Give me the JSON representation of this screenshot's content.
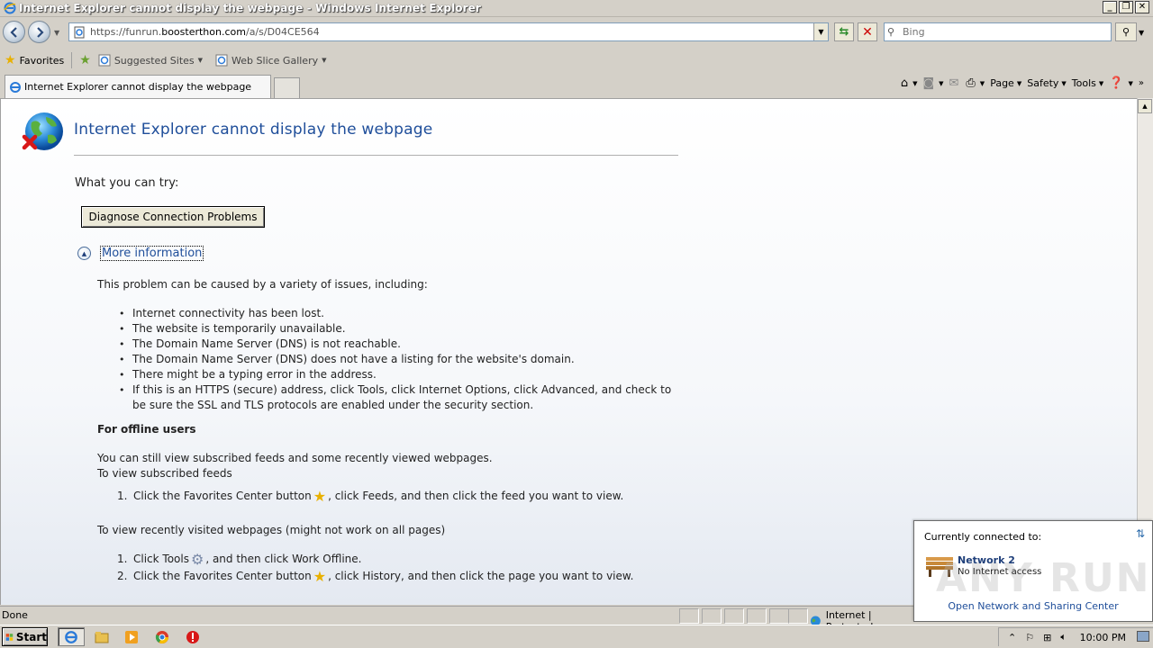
{
  "window": {
    "title": "Internet Explorer cannot display the webpage - Windows Internet Explorer",
    "controls": [
      "_",
      "❐",
      "✕"
    ]
  },
  "address": {
    "url_prefix": "https://funrun.",
    "url_domain": "boosterthon.com",
    "url_suffix": "/a/s/D04CE564"
  },
  "search": {
    "placeholder": "Bing"
  },
  "favorites_bar": {
    "favorites": "Favorites",
    "suggested_sites": "Suggested Sites",
    "web_slice_gallery": "Web Slice Gallery"
  },
  "tabs": [
    {
      "label": "Internet Explorer cannot display the webpage"
    }
  ],
  "command_bar": {
    "page": "Page",
    "safety": "Safety",
    "tools": "Tools"
  },
  "error_page": {
    "title": "Internet Explorer cannot display the webpage",
    "what_you_can_try": "What you can try:",
    "diagnose_button": "Diagnose Connection Problems",
    "more_information": "More information",
    "problem_intro": "This problem can be caused by a variety of issues, including:",
    "causes": [
      "Internet connectivity has been lost.",
      "The website is temporarily unavailable.",
      "The Domain Name Server (DNS) is not reachable.",
      "The Domain Name Server (DNS) does not have a listing for the website's domain.",
      "There might be a typing error in the address.",
      "If this is an HTTPS (secure) address, click Tools, click Internet Options, click Advanced, and check to be sure the SSL and TLS protocols are enabled under the security section."
    ],
    "offline_heading": "For offline users",
    "offline_line1": "You can still view subscribed feeds and some recently viewed webpages.",
    "offline_line2": "To view subscribed feeds",
    "feeds_step1_a": "Click the Favorites Center button",
    "feeds_step1_b": ", click Feeds, and then click the feed you want to view.",
    "recent_heading": "To view recently visited webpages (might not work on all pages)",
    "recent_step1_a": "Click Tools",
    "recent_step1_b": ", and then click Work Offline.",
    "recent_step2_a": "Click the Favorites Center button",
    "recent_step2_b": ", click History, and then click the page you want to view."
  },
  "status_bar": {
    "status": "Done",
    "zone": "Internet | Protected"
  },
  "network_popup": {
    "heading": "Currently connected to:",
    "network_name": "Network  2",
    "network_status": "No Internet access",
    "link": "Open Network and Sharing Center",
    "watermark": "ANY RUN"
  },
  "taskbar": {
    "start": "Start",
    "clock": "10:00 PM"
  },
  "colors": {
    "link_blue": "#1f4e9a",
    "chrome_gray": "#d4d0c8"
  }
}
